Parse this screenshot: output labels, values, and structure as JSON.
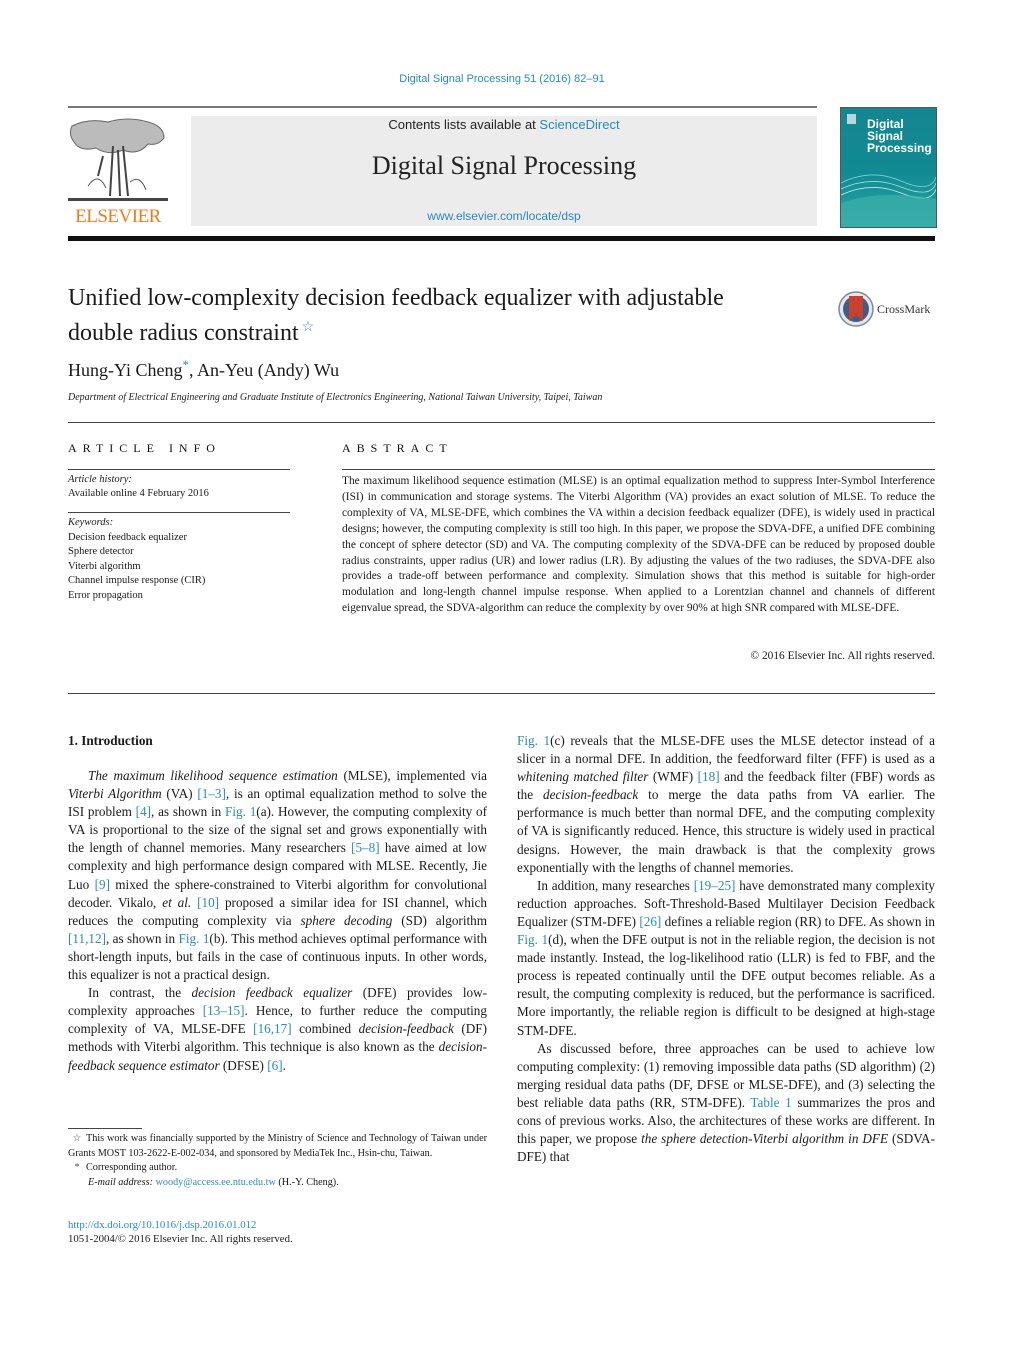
{
  "header": {
    "journal_ref": "Digital Signal Processing 51 (2016) 82–91",
    "contents_prefix": "Contents lists available at ",
    "contents_link": "ScienceDirect",
    "journal_title": "Digital Signal Processing",
    "journal_url": "www.elsevier.com/locate/dsp",
    "publisher": "ELSEVIER",
    "cover_title_lines": [
      "Digital",
      "Signal",
      "Processing"
    ],
    "crossmark_label": "CrossMark",
    "colors": {
      "link": "#2a8ab8",
      "elsevier_orange": "#f07a1f",
      "cover_teal": "#14868f",
      "masthead_gray": "#ececec"
    }
  },
  "article": {
    "title_line1": "Unified low-complexity decision feedback equalizer with adjustable",
    "title_line2": "double radius constraint",
    "title_star": "☆",
    "author1": "Hung-Yi Cheng",
    "author1_mark": "*",
    "author_sep": ", ",
    "author2": "An-Yeu (Andy) Wu",
    "affiliation": "Department of Electrical Engineering and Graduate Institute of Electronics Engineering, National Taiwan University, Taipei, Taiwan"
  },
  "article_info": {
    "heading": "ARTICLE INFO",
    "history_label": "Article history:",
    "history_value": "Available online 4 February 2016",
    "keywords_label": "Keywords:",
    "keywords": [
      "Decision feedback equalizer",
      "Sphere detector",
      "Viterbi algorithm",
      "Channel impulse response (CIR)",
      "Error propagation"
    ]
  },
  "abstract": {
    "heading": "ABSTRACT",
    "text": "The maximum likelihood sequence estimation (MLSE) is an optimal equalization method to suppress Inter-Symbol Interference (ISI) in communication and storage systems. The Viterbi Algorithm (VA) provides an exact solution of MLSE. To reduce the complexity of VA, MLSE-DFE, which combines the VA within a decision feedback equalizer (DFE), is widely used in practical designs; however, the computing complexity is still too high. In this paper, we propose the SDVA-DFE, a unified DFE combining the concept of sphere detector (SD) and VA. The computing complexity of the SDVA-DFE can be reduced by proposed double radius constraints, upper radius (UR) and lower radius (LR). By adjusting the values of the two radiuses, the SDVA-DFE also provides a trade-off between performance and complexity. Simulation shows that this method is suitable for high-order modulation and long-length channel impulse response. When applied to a Lorentzian channel and channels of different eigenvalue spread, the SDVA-algorithm can reduce the complexity by over 90% at high SNR compared with MLSE-DFE.",
    "copyright": "© 2016 Elsevier Inc. All rights reserved."
  },
  "body": {
    "section_heading": "1.  Introduction",
    "p1": {
      "s1_it": "The maximum likelihood sequence estimation",
      "s2": " (MLSE), implemented via ",
      "s3_it": "Viterbi Algorithm",
      "s4": " (VA) ",
      "r1": "[1–3]",
      "s5": ", is an optimal equalization method to solve the ISI problem ",
      "r2": "[4]",
      "s6": ", as shown in ",
      "r3": "Fig. 1",
      "s7": "(a). However, the computing complexity of VA is proportional to the size of the signal set and grows exponentially with the length of channel memories. Many researchers ",
      "r4": "[5–8]",
      "s8": " have aimed at low complexity and high performance design compared with MLSE. Recently, Jie Luo ",
      "r5": "[9]",
      "s9": " mixed the sphere-constrained to Viterbi algorithm for convolutional decoder. Vikalo, ",
      "s10_it": "et al.",
      "s11": " ",
      "r6": "[10]",
      "s12": " proposed a similar idea for ISI channel, which reduces the computing complexity via ",
      "s13_it": "sphere decoding",
      "s14": " (SD) algorithm ",
      "r7": "[11,12]",
      "s15": ", as shown in ",
      "r8": "Fig. 1",
      "s16": "(b). This method achieves optimal performance with short-length inputs, but fails in the case of continuous inputs. In other words, this equalizer is not a practical design."
    },
    "p2": {
      "s1": "In contrast, the ",
      "s2_it": "decision feedback equalizer",
      "s3": " (DFE) provides low-complexity approaches ",
      "r1": "[13–15]",
      "s4": ". Hence, to further reduce the computing complexity of VA, MLSE-DFE ",
      "r2": "[16,17]",
      "s5": " combined ",
      "s6_it": "decision-feedback",
      "s7": " (DF) methods with Viterbi algorithm. This technique is also known as the ",
      "s8_it": "decision-feedback sequence estimator",
      "s9": " (DFSE) ",
      "r3": "[6]",
      "s10": "."
    },
    "p3": {
      "r1": "Fig. 1",
      "s1": "(c) reveals that the MLSE-DFE uses the MLSE detector instead of a slicer in a normal DFE. In addition, the feedforward filter (FFF) is used as a ",
      "s2_it": "whitening matched filter",
      "s3": " (WMF) ",
      "r2": "[18]",
      "s4": " and the feedback filter (FBF) words as the ",
      "s5_it": "decision-feedback",
      "s6": " to merge the data paths from VA earlier. The performance is much better than normal DFE, and the computing complexity of VA is significantly reduced. Hence, this structure is widely used in practical designs. However, the main drawback is that the complexity grows exponentially with the lengths of channel memories."
    },
    "p4": {
      "s1": "In addition, many researches ",
      "r1": "[19–25]",
      "s2": " have demonstrated many complexity reduction approaches. Soft-Threshold-Based Multilayer Decision Feedback Equalizer (STM-DFE) ",
      "r2": "[26]",
      "s3": " defines a reliable region (RR) to DFE. As shown in ",
      "r3": "Fig. 1",
      "s4": "(d), when the DFE output is not in the reliable region, the decision is not made instantly. Instead, the log-likelihood ratio (LLR) is fed to FBF, and the process is repeated continually until the DFE output becomes reliable. As a result, the computing complexity is reduced, but the performance is sacrificed. More importantly, the reliable region is difficult to be designed at high-stage STM-DFE."
    },
    "p5": {
      "s1": "As discussed before, three approaches can be used to achieve low computing complexity: (1) removing impossible data paths (SD algorithm) (2) merging residual data paths (DF, DFSE or MLSE-DFE), and (3) selecting the best reliable data paths (RR, STM-DFE). ",
      "r1": "Table 1",
      "s2": " summarizes the pros and cons of previous works. Also, the architectures of these works are different. In this paper, we propose ",
      "s3_it": "the sphere detection-Viterbi algorithm in DFE",
      "s4": " (SDVA-DFE) that"
    }
  },
  "footnotes": {
    "fn1_mark": "☆",
    "fn1_text": "This work was financially supported by the Ministry of Science and Technology of Taiwan under Grants MOST 103-2622-E-002-034, and sponsored by MediaTek Inc., Hsin-chu, Taiwan.",
    "fn2_mark": "*",
    "fn2_text": "Corresponding author.",
    "email_label": "E-mail address:",
    "email": "woody@access.ee.ntu.edu.tw",
    "email_suffix": " (H.-Y. Cheng).",
    "doi": "http://dx.doi.org/10.1016/j.dsp.2016.01.012",
    "issn": "1051-2004/© 2016 Elsevier Inc. All rights reserved."
  }
}
